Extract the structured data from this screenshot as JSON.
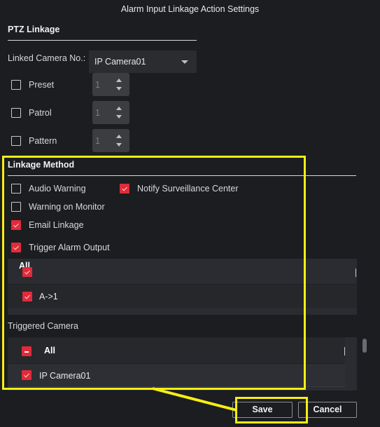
{
  "window": {
    "title": "Alarm Input Linkage Action Settings"
  },
  "ptz_linkage": {
    "heading": "PTZ Linkage",
    "linked_camera_label": "Linked Camera No.:",
    "linked_camera_value": "IP Camera01",
    "items": [
      {
        "label": "Preset",
        "checked": false,
        "value": "1"
      },
      {
        "label": "Patrol",
        "checked": false,
        "value": "1"
      },
      {
        "label": "Pattern",
        "checked": false,
        "value": "1"
      }
    ]
  },
  "linkage_method": {
    "heading": "Linkage Method",
    "options": [
      {
        "label": "Audio Warning",
        "checked": false
      },
      {
        "label": "Notify Surveillance Center",
        "checked": true
      },
      {
        "label": "Warning on Monitor",
        "checked": false
      },
      {
        "label": "Email Linkage",
        "checked": true
      },
      {
        "label": "Trigger Alarm Output",
        "checked": true
      }
    ],
    "alarm_output_list": {
      "header_label": "All",
      "header_checked": true,
      "rows": [
        {
          "label": "A->1",
          "checked": true
        }
      ]
    }
  },
  "triggered_camera": {
    "heading": "Triggered Camera",
    "header_label": "All",
    "header_state": "partial",
    "rows": [
      {
        "label": "IP Camera01",
        "checked": true
      }
    ]
  },
  "footer": {
    "save_label": "Save",
    "cancel_label": "Cancel"
  },
  "highlight_color": "#f7ee14",
  "accent_color": "#e22b3a"
}
